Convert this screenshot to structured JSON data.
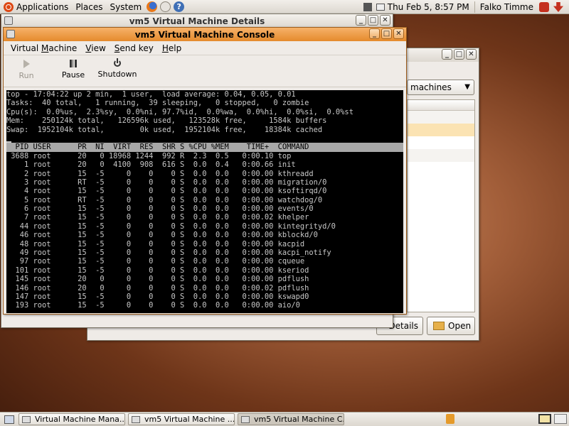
{
  "top_panel": {
    "applications": "Applications",
    "places": "Places",
    "system": "System",
    "clock": "Thu Feb  5,  8:57 PM",
    "user": "Falko Timme"
  },
  "details_window": {
    "title": "vm5 Virtual Machine Details"
  },
  "manager_window": {
    "combo_value": "machines",
    "details_button": "Details",
    "open_button": "Open"
  },
  "console_window": {
    "title": "vm5 Virtual Machine Console",
    "menu": [
      {
        "pre": "Virtual ",
        "u": "M",
        "post": "achine"
      },
      {
        "pre": "",
        "u": "V",
        "post": "iew"
      },
      {
        "pre": "",
        "u": "S",
        "post": "end key"
      },
      {
        "pre": "",
        "u": "H",
        "post": "elp"
      }
    ],
    "toolbar": {
      "run": "Run",
      "pause": "Pause",
      "shutdown": "Shutdown"
    },
    "terminal": {
      "summary": [
        "top - 17:04:22 up 2 min,  1 user,  load average: 0.04, 0.05, 0.01",
        "Tasks:  40 total,   1 running,  39 sleeping,   0 stopped,   0 zombie",
        "Cpu(s):  0.0%us,  2.3%sy,  0.0%ni, 97.7%id,  0.0%wa,  0.0%hi,  0.0%si,  0.0%st",
        "Mem:    250124k total,   126596k used,   123528k free,     1584k buffers",
        "Swap:  1952104k total,        0k used,  1952104k free,    18384k cached"
      ],
      "header": "  PID USER      PR  NI  VIRT  RES  SHR S %CPU %MEM    TIME+  COMMAND           ",
      "rows": [
        " 3688 root      20   0 18968 1244  992 R  2.3  0.5   0:00.10 top",
        "    1 root      20   0  4100  908  616 S  0.0  0.4   0:00.66 init",
        "    2 root      15  -5     0    0    0 S  0.0  0.0   0:00.00 kthreadd",
        "    3 root      RT  -5     0    0    0 S  0.0  0.0   0:00.00 migration/0",
        "    4 root      15  -5     0    0    0 S  0.0  0.0   0:00.00 ksoftirqd/0",
        "    5 root      RT  -5     0    0    0 S  0.0  0.0   0:00.00 watchdog/0",
        "    6 root      15  -5     0    0    0 S  0.0  0.0   0:00.00 events/0",
        "    7 root      15  -5     0    0    0 S  0.0  0.0   0:00.02 khelper",
        "   44 root      15  -5     0    0    0 S  0.0  0.0   0:00.00 kintegrityd/0",
        "   46 root      15  -5     0    0    0 S  0.0  0.0   0:00.00 kblockd/0",
        "   48 root      15  -5     0    0    0 S  0.0  0.0   0:00.00 kacpid",
        "   49 root      15  -5     0    0    0 S  0.0  0.0   0:00.00 kacpi_notify",
        "   97 root      15  -5     0    0    0 S  0.0  0.0   0:00.00 cqueue",
        "  101 root      15  -5     0    0    0 S  0.0  0.0   0:00.00 kseriod",
        "  145 root      20   0     0    0    0 S  0.0  0.0   0:00.00 pdflush",
        "  146 root      20   0     0    0    0 S  0.0  0.0   0:00.02 pdflush",
        "  147 root      15  -5     0    0    0 S  0.0  0.0   0:00.00 kswapd0",
        "  193 root      15  -5     0    0    0 S  0.0  0.0   0:00.00 aio/0"
      ]
    }
  },
  "taskbar": [
    "Virtual Machine Mana...",
    "vm5 Virtual Machine ...",
    "vm5 Virtual Machine C..."
  ]
}
